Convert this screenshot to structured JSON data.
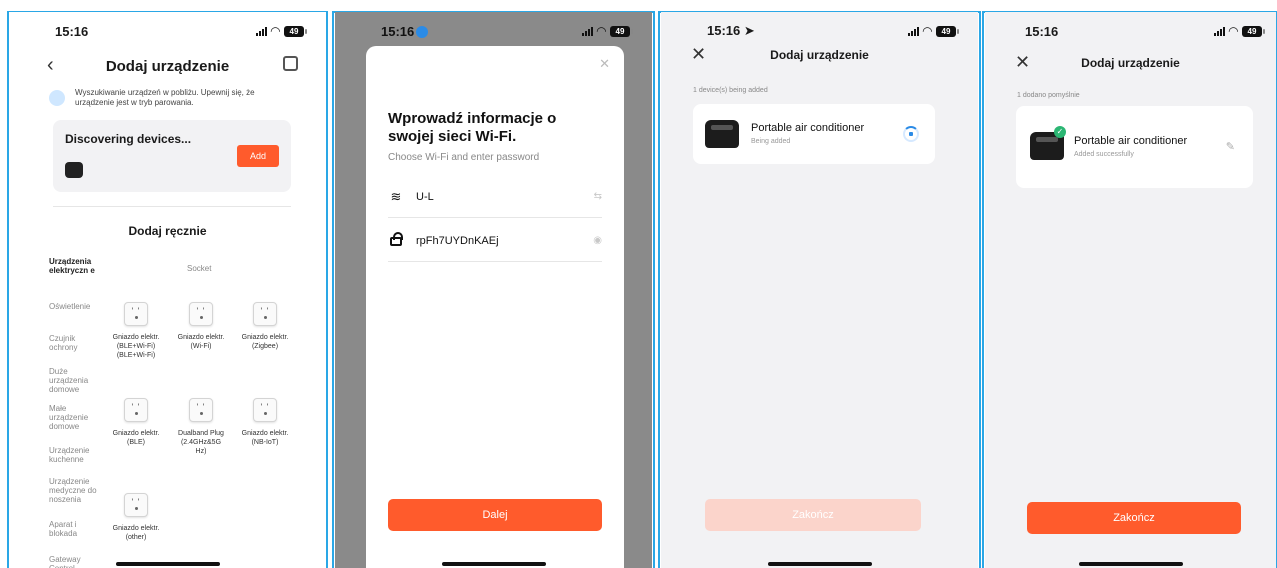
{
  "colors": {
    "accent": "#ff5b2c",
    "frame": "#2aa7e6",
    "success": "#2bb673"
  },
  "panel1": {
    "time": "15:16",
    "battery": "49",
    "title": "Dodaj urządzenie",
    "hint": "Wyszukiwanie urządzeń w pobliżu. Upewnij się, że urządzenie jest w tryb parowania.",
    "discovering": "Discovering devices...",
    "add_label": "Add",
    "manual_title": "Dodaj ręcznie",
    "socket_header": "Socket",
    "categories": [
      "Urządzenia elektryczn e",
      "Oświetlenie",
      "Czujnik ochrony",
      "Duże urządzenia domowe",
      "Małe urządzenie domowe",
      "Urządzenie kuchenne",
      "Urządzenie medyczne do noszenia",
      "Aparat i blokada",
      "Gateway Control"
    ],
    "sockets": [
      "Gniazdo elektr. (BLE+Wi-Fi) (BLE+Wi-Fi)",
      "Gniazdo elektr. (Wi-Fi)",
      "Gniazdo elektr. (Zigbee)",
      "Gniazdo elektr. (BLE)",
      "Dualband Plug (2.4GHz&5G Hz)",
      "Gniazdo elektr. (NB-IoT)",
      "Gniazdo elektr. (other)"
    ]
  },
  "panel2": {
    "time": "15:16",
    "battery": "49",
    "heading": "Wprowadź informacje o swojej sieci Wi-Fi.",
    "subheading": "Choose Wi-Fi and enter password",
    "ssid": "U-L",
    "password": "rpFh7UYDnKAEj",
    "next_label": "Dalej"
  },
  "panel3": {
    "time": "15:16",
    "battery": "49",
    "title": "Dodaj urządzenie",
    "count_label": "1 device(s) being added",
    "device_name": "Portable air conditioner",
    "device_status": "Being added",
    "done_label": "Zakończ"
  },
  "panel4": {
    "time": "15:16",
    "battery": "49",
    "title": "Dodaj urządzenie",
    "count_label": "1 dodano pomyślnie",
    "device_name": "Portable air conditioner",
    "device_status": "Added successfully",
    "done_label": "Zakończ"
  }
}
